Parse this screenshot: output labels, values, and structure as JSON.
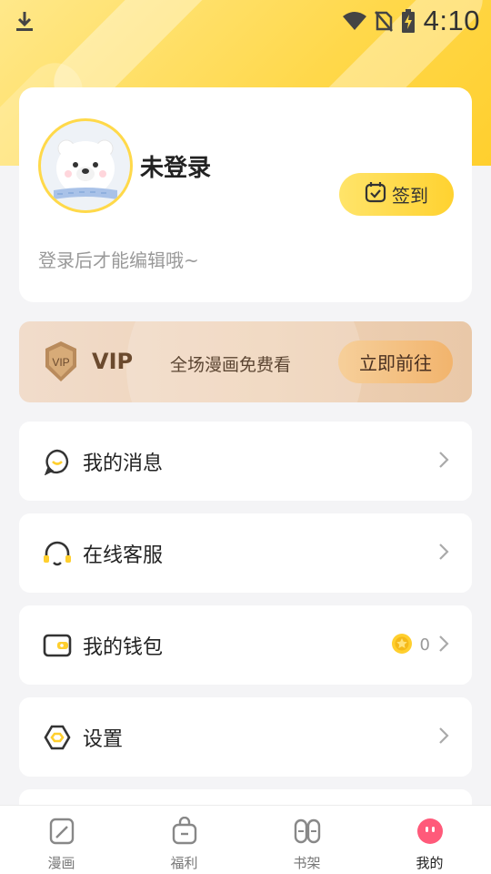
{
  "status_bar": {
    "time": "4:10",
    "icons": [
      "download-icon",
      "wifi-icon",
      "no-sim-icon",
      "battery-charging-icon"
    ]
  },
  "profile": {
    "username": "未登录",
    "hint": "登录后才能编辑哦~",
    "signin_label": "签到",
    "avatar": "polar-bear-avatar"
  },
  "vip": {
    "badge_text": "VIP",
    "title": "VIP",
    "description": "全场漫画免费看",
    "button_label": "立即前往"
  },
  "menu": {
    "messages": {
      "label": "我的消息",
      "icon": "message-bubble-icon"
    },
    "service": {
      "label": "在线客服",
      "icon": "headset-icon"
    },
    "wallet": {
      "label": "我的钱包",
      "icon": "wallet-icon",
      "coins": "0"
    },
    "settings": {
      "label": "设置",
      "icon": "hexagon-settings-icon"
    }
  },
  "tabs": [
    {
      "label": "漫画",
      "icon": "comic-icon",
      "active": false
    },
    {
      "label": "福利",
      "icon": "gift-bag-icon",
      "active": false
    },
    {
      "label": "书架",
      "icon": "bookshelf-icon",
      "active": false
    },
    {
      "label": "我的",
      "icon": "profile-face-icon",
      "active": true
    }
  ],
  "colors": {
    "brand_yellow": "#ffd84a",
    "vip_brown": "#6b4a2e",
    "active_tab_pink": "#ff5a7a"
  }
}
